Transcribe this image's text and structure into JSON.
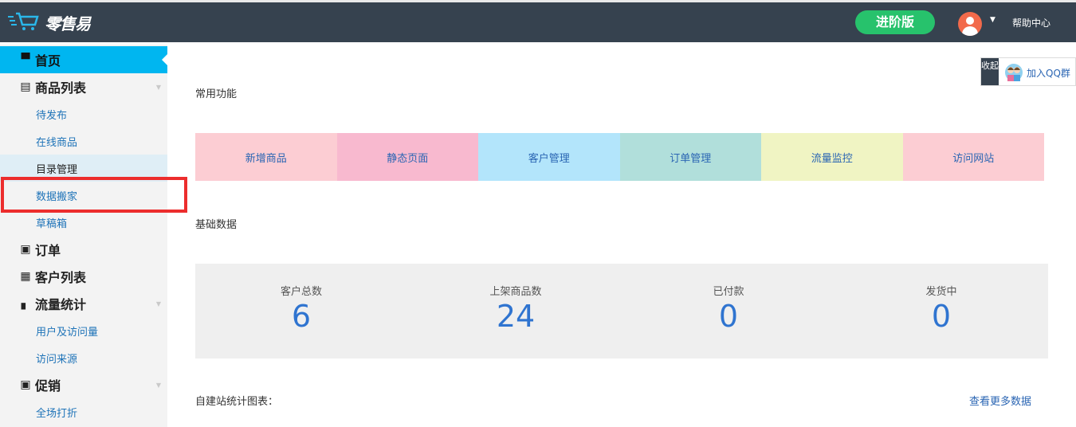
{
  "header": {
    "logo_text": "零售易",
    "pro_button": "进阶版",
    "help": "帮助中心"
  },
  "sidebar": {
    "items": [
      {
        "label": "首页"
      },
      {
        "label": "商品列表"
      },
      {
        "label": "待发布"
      },
      {
        "label": "在线商品"
      },
      {
        "label": "目录管理"
      },
      {
        "label": "数据搬家"
      },
      {
        "label": "草稿箱"
      },
      {
        "label": "订单"
      },
      {
        "label": "客户列表"
      },
      {
        "label": "流量统计"
      },
      {
        "label": "用户及访问量"
      },
      {
        "label": "访问来源"
      },
      {
        "label": "促销"
      },
      {
        "label": "全场打折"
      }
    ]
  },
  "main": {
    "common_title": "常用功能",
    "functions": [
      {
        "label": "新增商品",
        "color": "#fccdd3"
      },
      {
        "label": "静态页面",
        "color": "#f8b9cf"
      },
      {
        "label": "客户管理",
        "color": "#b3e5fb"
      },
      {
        "label": "订单管理",
        "color": "#b1dfdb"
      },
      {
        "label": "流量监控",
        "color": "#f0f4c3"
      },
      {
        "label": "访问网站",
        "color": "#fccdd3"
      }
    ],
    "basic_title": "基础数据",
    "stats": [
      {
        "label": "客户总数",
        "value": "6"
      },
      {
        "label": "上架商品数",
        "value": "24"
      },
      {
        "label": "已付款",
        "value": "0"
      },
      {
        "label": "发货中",
        "value": "0"
      }
    ],
    "chart_title": "自建站统计图表：",
    "more_link": "查看更多数据"
  },
  "qq_widget": {
    "collapse": "收起",
    "label": "加入QQ群"
  }
}
